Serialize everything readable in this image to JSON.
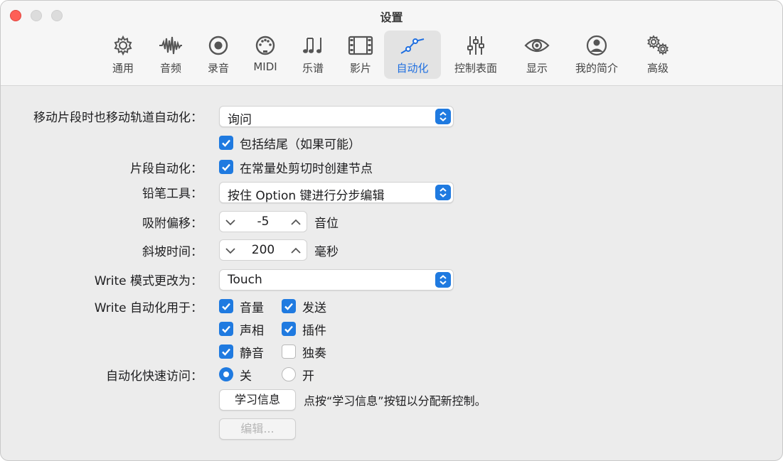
{
  "window": {
    "title": "设置"
  },
  "tabs": [
    {
      "key": "general",
      "label": "通用",
      "icon": "gear-icon"
    },
    {
      "key": "audio",
      "label": "音频",
      "icon": "waveform-icon"
    },
    {
      "key": "recording",
      "label": "录音",
      "icon": "record-icon"
    },
    {
      "key": "midi",
      "label": "MIDI",
      "icon": "midi-port-icon"
    },
    {
      "key": "score",
      "label": "乐谱",
      "icon": "music-notes-icon"
    },
    {
      "key": "movie",
      "label": "影片",
      "icon": "film-icon"
    },
    {
      "key": "automation",
      "label": "自动化",
      "icon": "automation-curve-icon",
      "active": true
    },
    {
      "key": "control-surfaces",
      "label": "控制表面",
      "icon": "faders-icon"
    },
    {
      "key": "display",
      "label": "显示",
      "icon": "eye-icon"
    },
    {
      "key": "my-info",
      "label": "我的简介",
      "icon": "person-circle-icon"
    },
    {
      "key": "advanced",
      "label": "高级",
      "icon": "gears-icon"
    }
  ],
  "form": {
    "move_automation": {
      "label": "移动片段时也移动轨道自动化：",
      "value": "询问"
    },
    "include_tails": {
      "label": "包括结尾（如果可能）",
      "checked": true
    },
    "region_automation": {
      "label": "片段自动化：",
      "option": "在常量处剪切时创建节点",
      "checked": true
    },
    "pencil_tool": {
      "label": "铅笔工具：",
      "value": "按住 Option 键进行分步编辑"
    },
    "snap_offset": {
      "label": "吸附偏移：",
      "value": "-5",
      "unit": "音位"
    },
    "ramp_time": {
      "label": "斜坡时间：",
      "value": "200",
      "unit": "毫秒"
    },
    "write_mode": {
      "label": "Write 模式更改为：",
      "value": "Touch"
    },
    "write_for": {
      "label": "Write 自动化用于：",
      "options": [
        {
          "label": "音量",
          "checked": true
        },
        {
          "label": "发送",
          "checked": true
        },
        {
          "label": "声相",
          "checked": true
        },
        {
          "label": "插件",
          "checked": true
        },
        {
          "label": "静音",
          "checked": true
        },
        {
          "label": "独奏",
          "checked": false
        }
      ]
    },
    "quick_access": {
      "label": "自动化快速访问：",
      "options": [
        {
          "label": "关",
          "selected": true
        },
        {
          "label": "开",
          "selected": false
        }
      ]
    },
    "learn_button": "学习信息",
    "learn_hint": "点按“学习信息”按钮以分配新控制。",
    "edit_button": "编辑..."
  },
  "colors": {
    "accent": "#1f7ae0",
    "active_tab_label": "#1f6fe0",
    "close": "#fe5f57"
  }
}
